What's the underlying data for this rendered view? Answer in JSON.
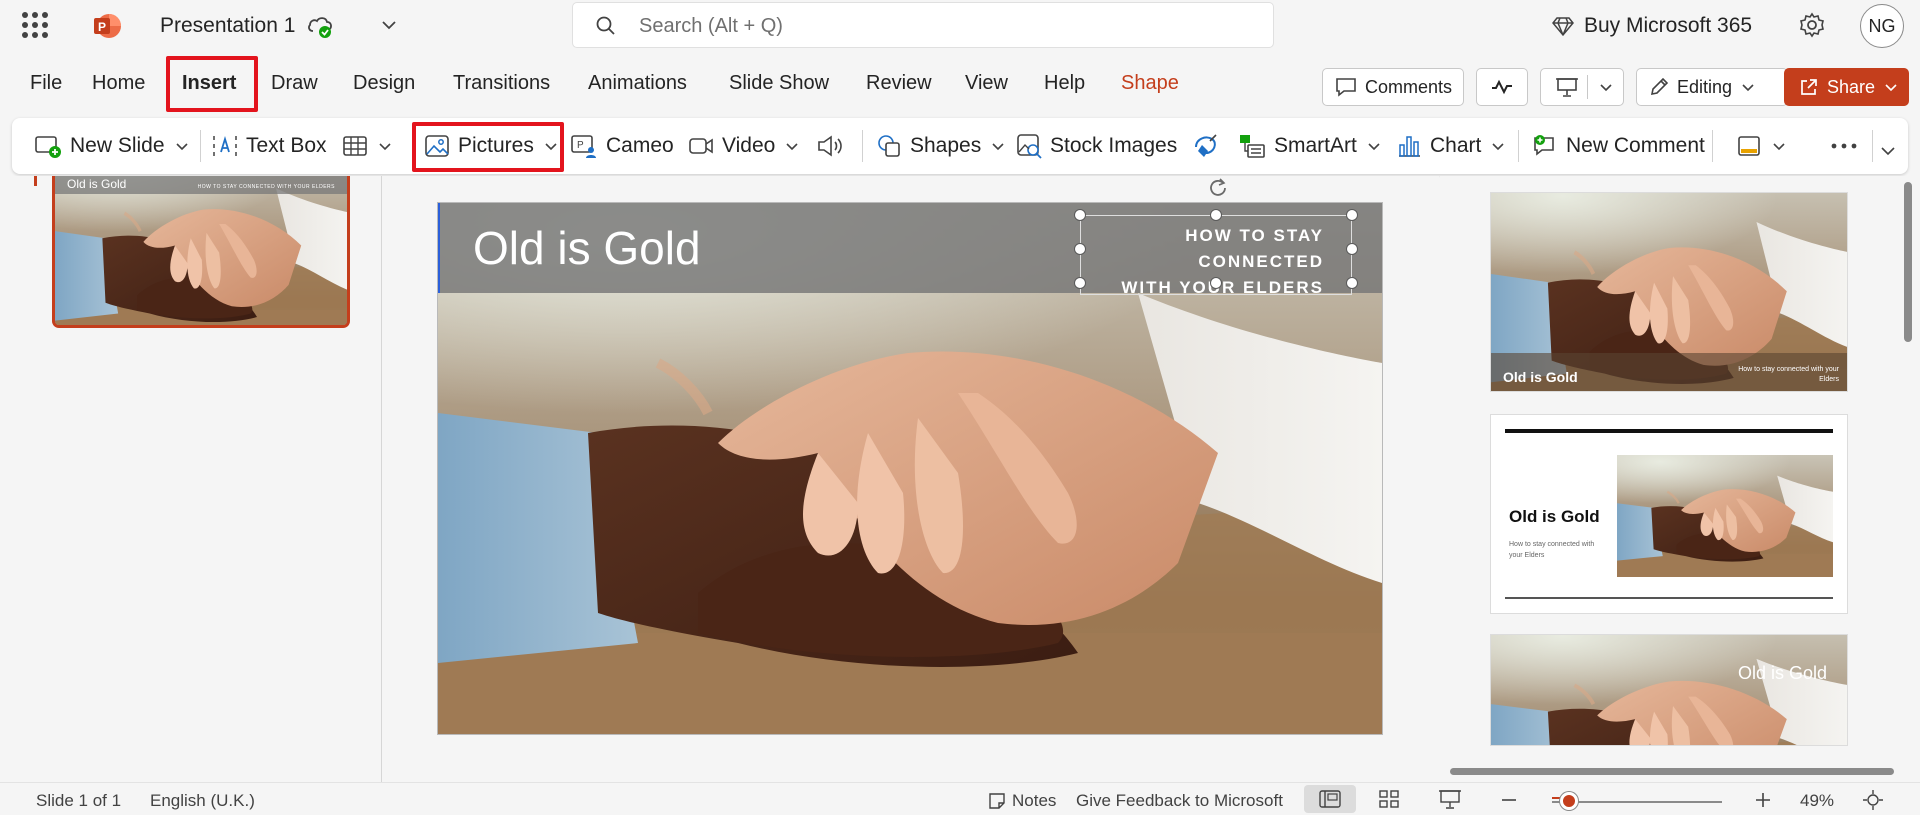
{
  "app": {
    "doc_title": "Presentation 1",
    "search_placeholder": "Search (Alt + Q)",
    "buy_label": "Buy Microsoft 365",
    "avatar_initials": "NG"
  },
  "ribbon_tabs": {
    "file": "File",
    "home": "Home",
    "insert": "Insert",
    "draw": "Draw",
    "design": "Design",
    "transitions": "Transitions",
    "animations": "Animations",
    "slide_show": "Slide Show",
    "review": "Review",
    "view": "View",
    "help": "Help",
    "shape": "Shape"
  },
  "ribbon_right": {
    "comments": "Comments",
    "editing": "Editing",
    "share": "Share"
  },
  "toolbar": {
    "new_slide": "New Slide",
    "text_box": "Text Box",
    "pictures": "Pictures",
    "cameo": "Cameo",
    "video": "Video",
    "shapes": "Shapes",
    "stock_images": "Stock Images",
    "smartart": "SmartArt",
    "chart": "Chart",
    "new_comment": "New Comment"
  },
  "slide": {
    "title": "Old is Gold",
    "subtitle_line1": "HOW TO STAY CONNECTED",
    "subtitle_line2": "WITH YOUR ELDERS"
  },
  "left_thumbnail": {
    "title": "Old is Gold",
    "subtitle": "HOW TO STAY CONNECTED WITH YOUR ELDERS"
  },
  "designs": [
    {
      "title": "Old is Gold",
      "subtitle": "How to stay connected with your Elders"
    },
    {
      "title": "Old is Gold",
      "subtitle": "How to stay connected with your Elders"
    },
    {
      "title": "Old is Gold"
    }
  ],
  "status": {
    "slide_count": "Slide 1 of 1",
    "language": "English (U.K.)",
    "notes": "Notes",
    "feedback": "Give Feedback to Microsoft",
    "zoom": "49%"
  },
  "colors": {
    "accent": "#c43e1c",
    "highlight": "#e3141d",
    "share_bg": "#c43e1c"
  }
}
